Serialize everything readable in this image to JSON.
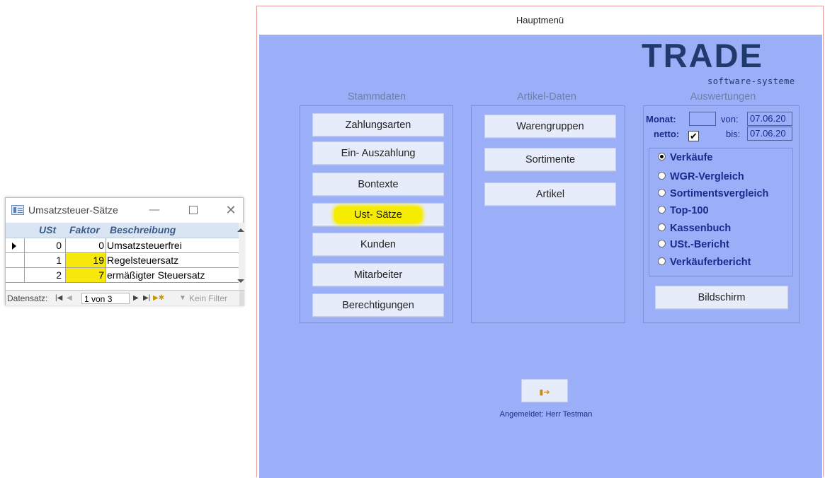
{
  "datasheet": {
    "title": "Umsatzsteuer-Sätze",
    "columns": [
      "USt",
      "Faktor",
      "Beschreibung"
    ],
    "rows": [
      {
        "ust": "0",
        "faktor": "0",
        "beschreibung": "Umsatzsteuerfrei",
        "current": true,
        "highlight": false
      },
      {
        "ust": "1",
        "faktor": "19",
        "beschreibung": "Regelsteuersatz",
        "current": false,
        "highlight": true
      },
      {
        "ust": "2",
        "faktor": "7",
        "beschreibung": "ermäßigter Steuersatz",
        "current": false,
        "highlight": true
      }
    ],
    "nav": {
      "label": "Datensatz:",
      "record": "1 von 3",
      "filter": "Kein Filter"
    },
    "highlight_color": "#f7e80c"
  },
  "main": {
    "title": "Hauptmenü",
    "logo": {
      "text": "TRADE",
      "sub": "software-systeme"
    },
    "stammdaten": {
      "title": "Stammdaten",
      "buttons": [
        "Zahlungsarten",
        "Ein- Auszahlung",
        "Bontexte",
        "Ust- Sätze",
        "Kunden",
        "Mitarbeiter",
        "Berechtigungen"
      ]
    },
    "artikel": {
      "title": "Artikel-Daten",
      "buttons": [
        "Warengruppen",
        "Sortimente",
        "Artikel"
      ]
    },
    "auswertungen": {
      "title": "Auswertungen",
      "monat_label": "Monat:",
      "monat_value": "",
      "von_label": "von:",
      "von_value": "07.06.20",
      "netto_label": "netto:",
      "netto_checked": true,
      "bis_label": "bis:",
      "bis_value": "07.06.20",
      "options": [
        "Verkäufe",
        "WGR-Vergleich",
        "Sortimentsvergleich",
        "Top-100",
        "Kassenbuch",
        "USt.-Bericht",
        "Verkäuferbericht"
      ],
      "selected": "Verkäufe",
      "output_button": "Bildschirm"
    },
    "exit_icon": "exit-door-icon",
    "login_text": "Angemeldet: Herr Testman",
    "colors": {
      "form_bg": "#9aaff8",
      "button_bg": "#e7ecfa",
      "highlight": "#f5ec00",
      "label_text": "#1a2b8c"
    }
  }
}
